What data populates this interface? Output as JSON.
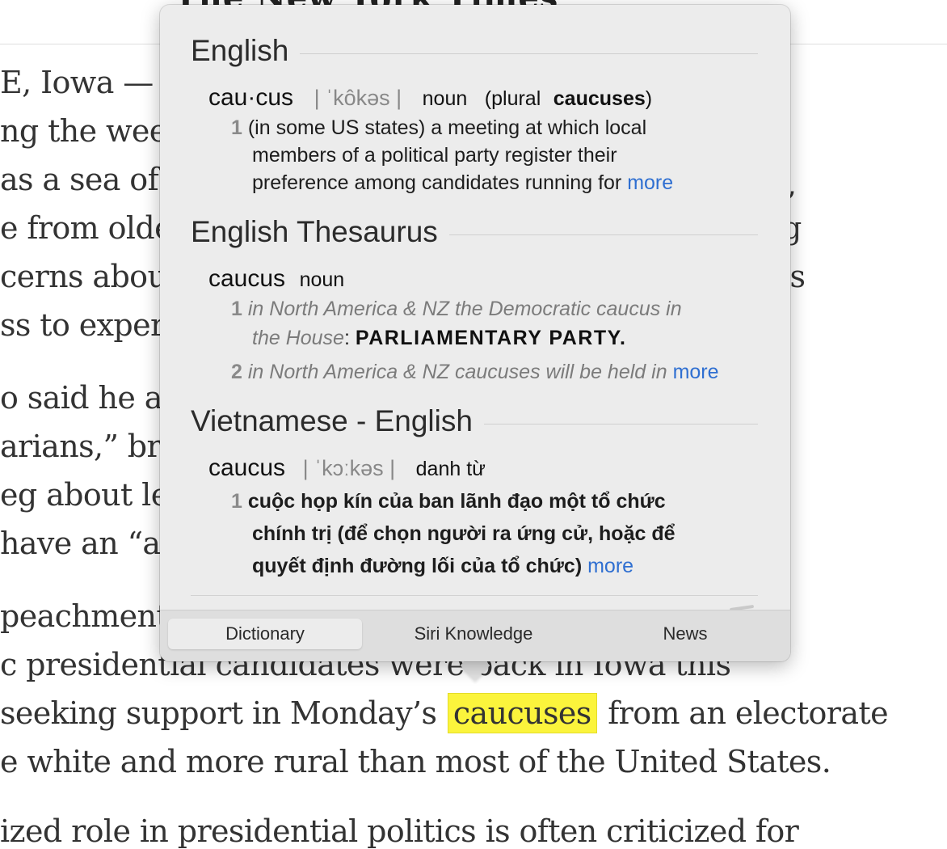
{
  "article": {
    "masthead": "The New York Times",
    "lines": [
      "E, Iowa — L",
      "ng the week",
      "as a sea of g",
      "e from older",
      "cerns abou",
      "ss to experi",
      "o said he and",
      "arians,” bro",
      "eg about leg",
      "have an “ass",
      "peachment",
      "c presidential candidates were back in Iowa this",
      "seeking support in Monday’s",
      "from an electorate",
      "e white and more rural than most of the United States.",
      "ized role in presidential politics is often criticized for"
    ],
    "right_fragments": [
      ",",
      "g",
      "is"
    ],
    "highlighted_word": "caucuses"
  },
  "popover": {
    "sections": {
      "english": {
        "title": "English",
        "headword": "cau·cus",
        "pronunciation": "| ˈkôkəs |",
        "pos": "noun",
        "plural_prefix": "(plural",
        "plural_word": "caucuses",
        "plural_suffix": ")",
        "def_number": "1",
        "def_lines": [
          "(in some US states) a meeting at which local",
          "members of a political party register their",
          "preference among candidates running for"
        ],
        "more": "more"
      },
      "thesaurus": {
        "title": "English Thesaurus",
        "headword": "caucus",
        "pos": "noun",
        "sense1_number": "1",
        "sense1_example_a": "in North America & NZ",
        "sense1_example_b": "the Democratic caucus in",
        "sense1_example_c": "the House",
        "sense1_colon": ":",
        "sense1_synonym": "PARLIAMENTARY PARTY.",
        "sense2_number": "2",
        "sense2_example_a": "in North America & NZ",
        "sense2_example_b": "caucuses will be held in",
        "more": "more"
      },
      "vietnamese": {
        "title": "Vietnamese - English",
        "headword": "caucus",
        "pronunciation": "| ˈkɔːkəs |",
        "pos": "danh từ",
        "def_number": "1",
        "def_lines": [
          "cuộc họp kín của ban lãnh đạo một tổ chức",
          "chính trị (để chọn người ra ứng cử, hoặc để",
          "quyết định đường lối của tổ chức)"
        ],
        "more": "more"
      }
    },
    "tabs": [
      "Dictionary",
      "Siri Knowledge",
      "News"
    ],
    "active_tab": "Dictionary"
  },
  "colors": {
    "highlight": "#fbf43c",
    "link": "#2f6fd1",
    "popover_bg": "#ececec"
  }
}
